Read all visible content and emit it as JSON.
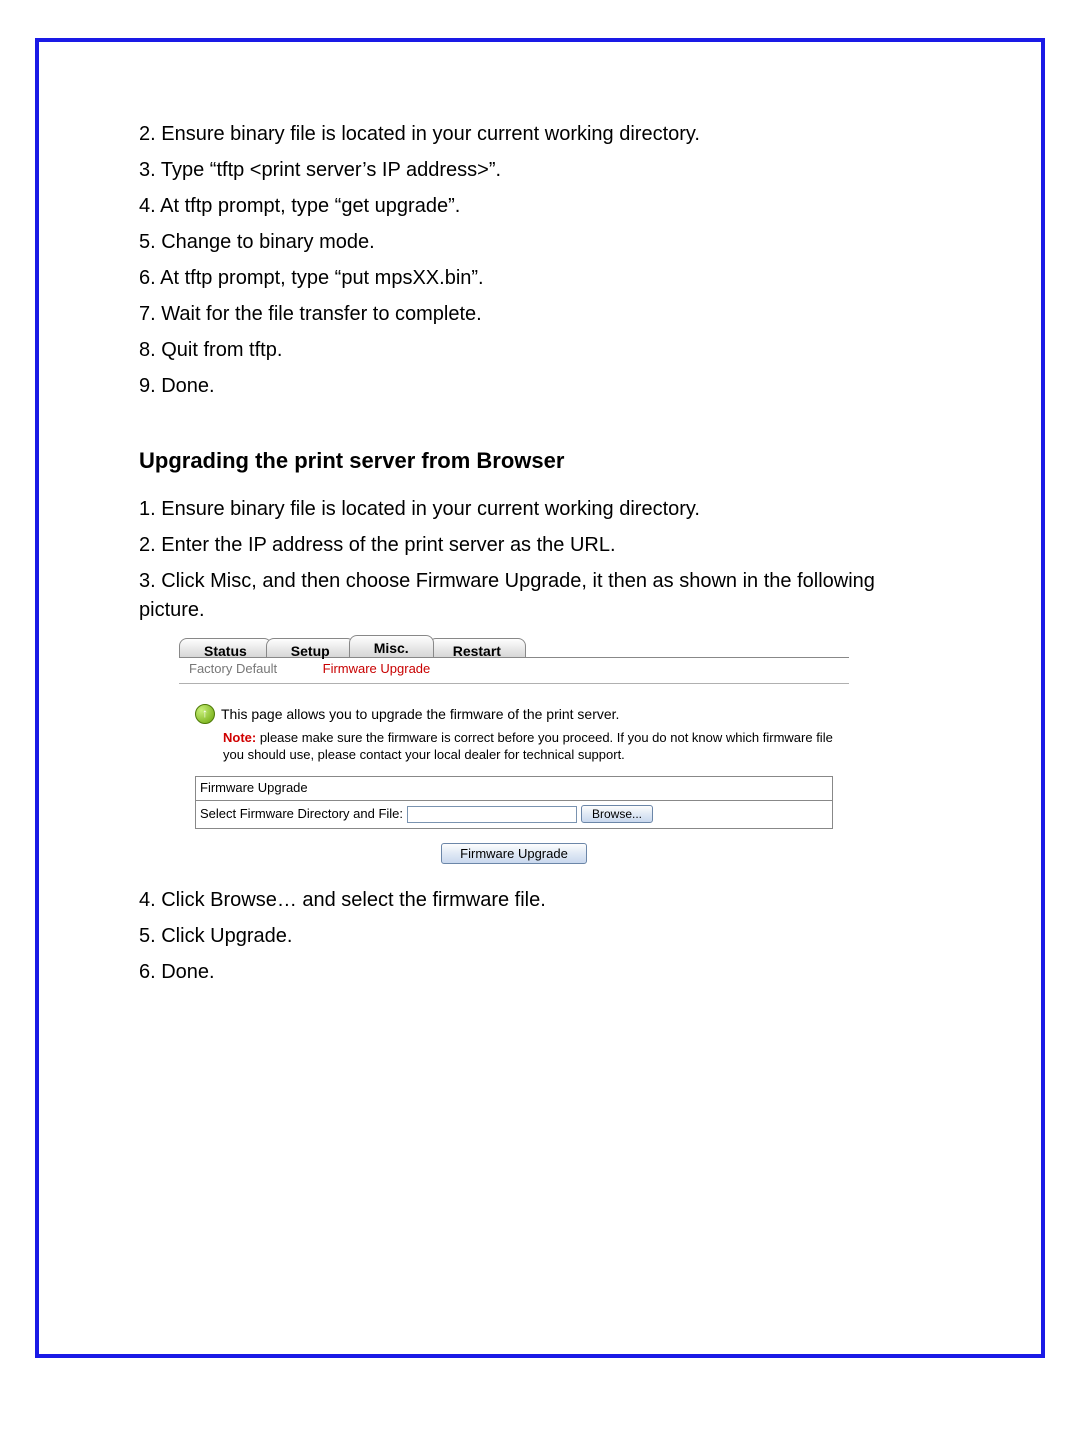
{
  "tftp_steps": {
    "s2": "2. Ensure binary file is located in your current working directory.",
    "s3": "3. Type “tftp <print server’s IP address>”.",
    "s4": "4. At tftp prompt, type “get upgrade”.",
    "s5": "5. Change to binary mode.",
    "s6": "6. At tftp prompt, type “put mpsXX.bin”.",
    "s7": "7. Wait for the file transfer to complete.",
    "s8": "8. Quit from tftp.",
    "s9": "9. Done."
  },
  "section_title": "Upgrading the print server from Browser",
  "browser_steps_a": {
    "s1": "1. Ensure binary file is located in your current working directory.",
    "s2": "2. Enter the IP address of the print server as the URL.",
    "s3": "3. Click Misc, and then choose Firmware Upgrade, it then as shown in the following picture."
  },
  "browser_steps_b": {
    "s4": "4. Click Browse… and select the firmware file.",
    "s5": "5. Click Upgrade.",
    "s6": "6. Done."
  },
  "shot": {
    "tabs": {
      "status": "Status",
      "setup": "Setup",
      "misc": "Misc.",
      "restart": "Restart"
    },
    "subnav": {
      "factory_default": "Factory Default",
      "firmware_upgrade": "Firmware Upgrade"
    },
    "info_text": "This page allows you to upgrade the firmware of the print server.",
    "note_label": "Note:",
    "note_text": " please make sure the firmware is correct before you proceed. If you do not know which firmware file you should use, please contact your local dealer for technical support.",
    "box_header": "Firmware Upgrade",
    "file_label": "Select Firmware Directory and File:",
    "browse_btn": "Browse...",
    "upgrade_btn": "Firmware Upgrade"
  }
}
